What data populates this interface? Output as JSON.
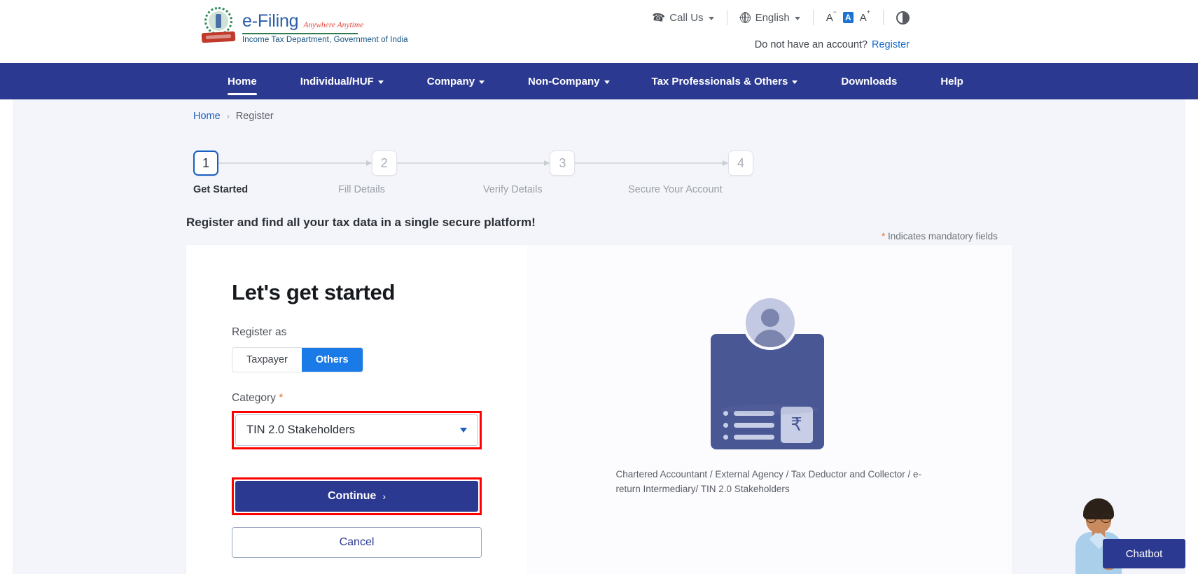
{
  "header": {
    "brand": {
      "main": "e-Filing",
      "tagline": "Anywhere Anytime",
      "subtitle": "Income Tax Department, Government of India",
      "emblem_icon": "india-emblem-icon"
    },
    "call_us": "Call Us",
    "language": "English",
    "font_decrease": "A",
    "font_normal": "A",
    "font_increase": "A",
    "contrast_icon": "contrast-icon",
    "account_prompt": "Do not have an account?",
    "register_link": "Register"
  },
  "nav": {
    "items": [
      {
        "label": "Home",
        "has_caret": false,
        "active": true
      },
      {
        "label": "Individual/HUF",
        "has_caret": true,
        "active": false
      },
      {
        "label": "Company",
        "has_caret": true,
        "active": false
      },
      {
        "label": "Non-Company",
        "has_caret": true,
        "active": false
      },
      {
        "label": "Tax Professionals & Others",
        "has_caret": true,
        "active": false
      },
      {
        "label": "Downloads",
        "has_caret": false,
        "active": false
      },
      {
        "label": "Help",
        "has_caret": false,
        "active": false
      }
    ]
  },
  "breadcrumb": {
    "home": "Home",
    "separator": "›",
    "current": "Register"
  },
  "stepper": {
    "steps": [
      {
        "num": "1",
        "label": "Get Started",
        "active": true
      },
      {
        "num": "2",
        "label": "Fill Details",
        "active": false
      },
      {
        "num": "3",
        "label": "Verify Details",
        "active": false
      },
      {
        "num": "4",
        "label": "Secure Your Account",
        "active": false
      }
    ]
  },
  "intro_text": "Register and find all your tax data in a single secure platform!",
  "mandatory_note": {
    "star": "*",
    "text": "Indicates mandatory fields"
  },
  "form": {
    "title": "Let's get started",
    "register_as_label": "Register as",
    "toggle": {
      "option_taxpayer": "Taxpayer",
      "option_others": "Others",
      "selected": "Others"
    },
    "category_label": "Category",
    "category_required_star": "*",
    "category_value": "TIN 2.0 Stakeholders",
    "category_options": [
      "Chartered Accountant",
      "External Agency",
      "Tax Deductor and Collector",
      "e-return Intermediary",
      "TIN 2.0 Stakeholders"
    ],
    "continue_label": "Continue",
    "continue_chevron": "›",
    "cancel_label": "Cancel"
  },
  "illustration": {
    "icon": "id-card-with-avatar-icon",
    "rupee_symbol": "₹",
    "caption": "Chartered Accountant / External Agency / Tax Deductor and Collector / e-return Intermediary/ TIN 2.0 Stakeholders"
  },
  "chatbot": {
    "label": "Chatbot",
    "avatar_icon": "chatbot-avatar-icon"
  },
  "colors": {
    "navy": "#2b3990",
    "accent_blue": "#1a7ae8",
    "link_blue": "#1669c9",
    "highlight_red": "#ff0000",
    "required_orange": "#e8702a",
    "page_bg": "#f4f5fa"
  }
}
